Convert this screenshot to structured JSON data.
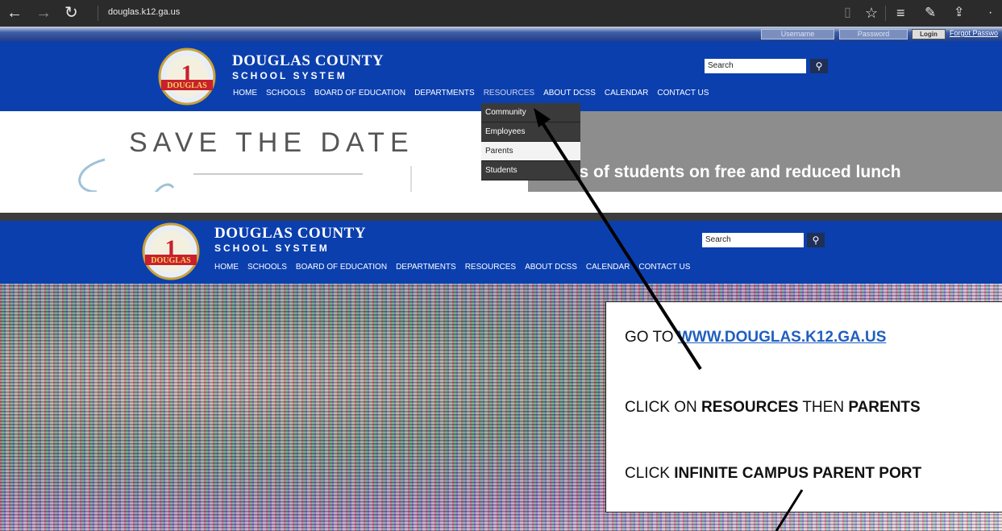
{
  "browser": {
    "address": "douglas.k12.ga.us",
    "icons": [
      "back-arrow-icon",
      "forward-arrow-icon",
      "refresh-icon",
      "reading-view-icon",
      "favorite-star-icon",
      "hub-icon",
      "web-note-icon",
      "share-icon",
      "more-icon"
    ]
  },
  "login": {
    "username_placeholder": "Username",
    "password_placeholder": "Password",
    "login_label": "Login",
    "forgot_label": "Forgot Passwo"
  },
  "site": {
    "brand_line1": "DOUGLAS COUNTY",
    "brand_line2": "SCHOOL SYSTEM",
    "logo_text": "DOUGLAS",
    "logo_number": "1",
    "search_placeholder": "Search",
    "nav": [
      "HOME",
      "SCHOOLS",
      "BOARD OF EDUCATION",
      "DEPARTMENTS",
      "RESOURCES",
      "ABOUT DCSS",
      "CALENDAR",
      "CONTACT US"
    ],
    "colors": {
      "header_blue": "#0b3fae",
      "dropdown_dark": "#3a3a3a",
      "panel_gray": "#8d8d8d"
    }
  },
  "dropdown": {
    "items": [
      "Community",
      "Employees",
      "Parents",
      "Students"
    ],
    "active": "Parents"
  },
  "hero": {
    "save_the_date": "SAVE THE DATE",
    "lunch_text": "ents of students on free and reduced lunch"
  },
  "instructions": {
    "line1_prefix": "GO TO ",
    "line1_link": "WWW.DOUGLAS.K12.GA.US",
    "line2_prefix": "CLICK ON ",
    "line2_bold1": "RESOURCES",
    "line2_mid": " THEN ",
    "line2_bold2": "PARENTS",
    "line3_prefix": "CLICK ",
    "line3_bold": "INFINITE CAMPUS PARENT PORT"
  }
}
